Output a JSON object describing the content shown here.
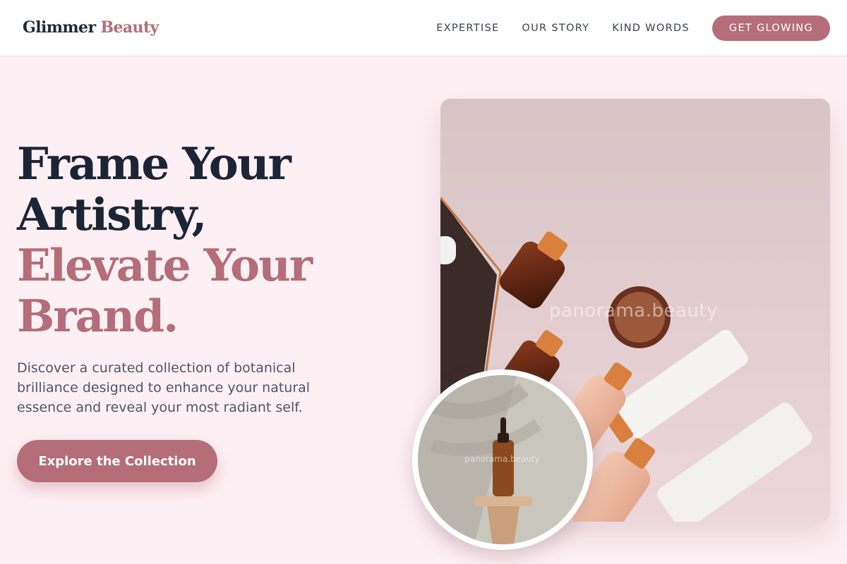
{
  "header": {
    "logo_part1": "Glimmer",
    "logo_part2": "Beauty",
    "nav": [
      "EXPERTISE",
      "OUR STORY",
      "KIND WORDS"
    ],
    "cta_label": "GET GLOWING"
  },
  "hero": {
    "headline_dark": [
      "Frame Your",
      "Artistry,"
    ],
    "headline_accent": [
      "Elevate Your",
      "Brand."
    ],
    "description": "Discover a curated collection of botanical brilliance designed to enhance your natural essence and reveal your most radiant self.",
    "cta_label": "Explore the Collection"
  },
  "images": {
    "main_watermark": "panorama.beauty",
    "circle_watermark": "panorama.beauty"
  },
  "colors": {
    "accent": "#b46d79",
    "dark": "#1c2535",
    "background": "#fdf0f4"
  }
}
